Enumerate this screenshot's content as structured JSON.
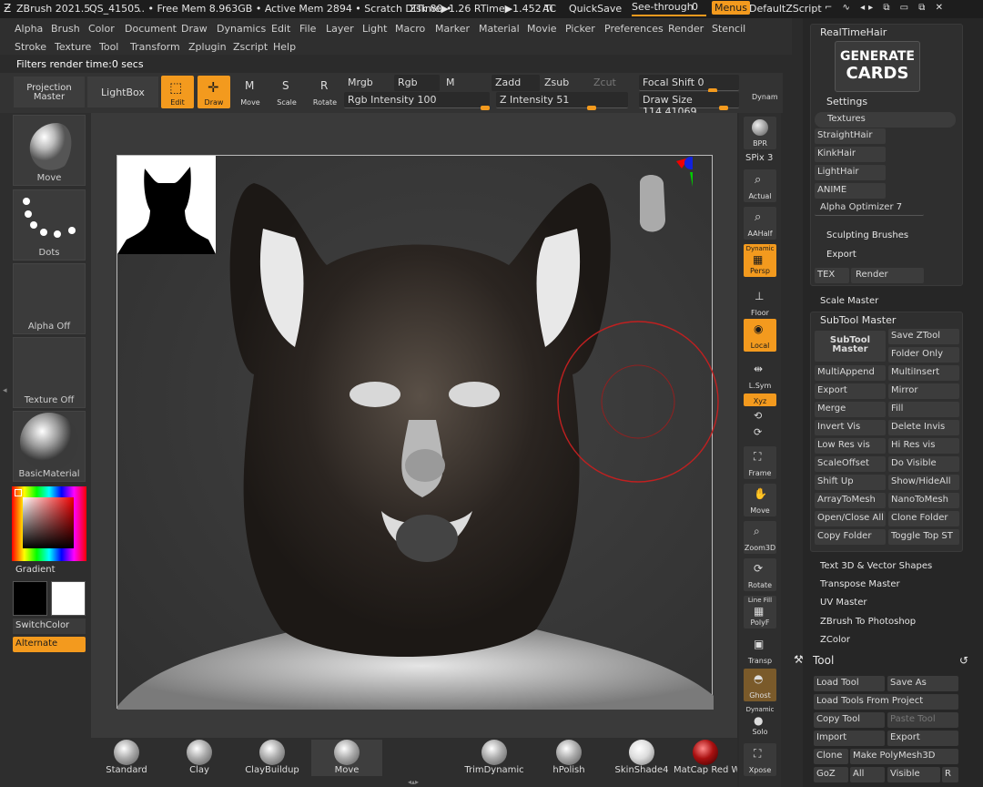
{
  "titlebar": {
    "app": "ZBrush 2021.5",
    "file": "QS_41505",
    "mem": ".. • Free Mem 8.963GB • Active Mem 2894 • Scratch Disk 80 •",
    "ztime": "ZTime▶1.26 RTime▶1.452 Ti",
    "ac": "AC",
    "quicksave": "QuickSave",
    "seethrough": "See-through",
    "seethrough_val": "0",
    "menus": "Menus",
    "script": "DefaultZScript"
  },
  "menubar": {
    "row1": [
      "Alpha",
      "Brush",
      "Color",
      "Document",
      "Draw",
      "Dynamics",
      "Edit",
      "File",
      "Layer",
      "Light",
      "Macro",
      "Marker",
      "Material",
      "Movie",
      "Picker",
      "Preferences",
      "Render",
      "Stencil"
    ],
    "row2": [
      "Stroke",
      "Texture",
      "Tool",
      "Transform",
      "Zplugin",
      "Zscript",
      "Help"
    ]
  },
  "status": "Filters render time:0 secs",
  "toolbar": {
    "projection_master": "Projection Master",
    "lightbox": "LightBox",
    "edit": "Edit",
    "draw": "Draw",
    "move": "Move",
    "scale": "Scale",
    "rotate": "Rotate",
    "mrgb": "Mrgb",
    "rgb": "Rgb",
    "m": "M",
    "rgb_intensity": "Rgb Intensity 100",
    "zadd": "Zadd",
    "zsub": "Zsub",
    "zcut": "Zcut",
    "z_intensity": "Z Intensity 51",
    "focal_shift": "Focal Shift 0",
    "draw_size": "Draw Size 114.41069",
    "dynamic": "Dynam"
  },
  "leftpanel": {
    "brush": "Move",
    "stroke": "Dots",
    "alpha": "Alpha Off",
    "texture": "Texture Off",
    "material": "BasicMaterial",
    "gradient": "Gradient",
    "switchcolor": "SwitchColor",
    "alternate": "Alternate"
  },
  "rightshelf": {
    "bpr": "BPR",
    "spix": "SPix 3",
    "actual": "Actual",
    "aahalf": "AAHalf",
    "dynamic": "Dynamic",
    "persp": "Persp",
    "floor": "Floor",
    "local": "Local",
    "lsym": "L.Sym",
    "xyz": "Xyz",
    "frame": "Frame",
    "move": "Move",
    "zoom3d": "Zoom3D",
    "rotate": "Rotate",
    "linefill": "Line Fill",
    "polyf": "PolyF",
    "transp": "Transp",
    "ghost": "Ghost",
    "dynamic2": "Dynamic",
    "solo": "Solo",
    "xpose": "Xpose"
  },
  "bottomshelf": [
    "Standard",
    "Clay",
    "ClayBuildup",
    "Move",
    "TrimDynamic",
    "hPolish",
    "SkinShade4",
    "MatCap Red W"
  ],
  "rightpanel": {
    "realtimehair": "RealTimeHair",
    "generate": "GENERATE",
    "cards": "CARDS",
    "settings": "Settings",
    "textures": "Textures",
    "straighthair": "StraightHair",
    "kinkhair": "KinkHair",
    "lighthair": "LightHair",
    "anime": "ANIME",
    "alpha_optimizer": "Alpha Optimizer 7",
    "sculpting_brushes": "Sculpting Brushes",
    "export": "Export",
    "tex": "TEX",
    "render": "Render",
    "scale_master": "Scale Master",
    "subtool_master": "SubTool Master",
    "subtool_master_btn": "SubTool Master",
    "stm_buttons": [
      [
        "Save ZTool"
      ],
      [
        "Folder Only"
      ],
      [
        "MultiAppend",
        "MultiInsert"
      ],
      [
        "Export",
        "Mirror"
      ],
      [
        "Merge",
        "Fill"
      ],
      [
        "Invert Vis",
        "Delete Invis"
      ],
      [
        "Low Res vis",
        "Hi Res vis"
      ],
      [
        "ScaleOffset",
        "Do Visible"
      ],
      [
        "Shift Up",
        "Show/HideAll"
      ],
      [
        "ArrayToMesh",
        "NanoToMesh"
      ],
      [
        "Open/Close All",
        "Clone Folder"
      ],
      [
        "Copy Folder",
        "Toggle Top ST"
      ]
    ],
    "text3d": "Text 3D & Vector Shapes",
    "transpose_master": "Transpose Master",
    "uv_master": "UV Master",
    "zbrush_to_photoshop": "ZBrush To Photoshop",
    "zcolor": "ZColor",
    "tool": "Tool",
    "tool_buttons": [
      [
        "Load Tool",
        "Save As"
      ],
      [
        "Load Tools From Project"
      ],
      [
        "Copy Tool",
        "Paste Tool"
      ],
      [
        "Import",
        "Export"
      ],
      [
        "Clone",
        "Make PolyMesh3D"
      ],
      [
        "GoZ",
        "All",
        "Visible",
        "R"
      ]
    ]
  },
  "colors": {
    "accent": "#f39a1e",
    "panel": "#2f2f2f",
    "button": "#3c3c3c"
  }
}
